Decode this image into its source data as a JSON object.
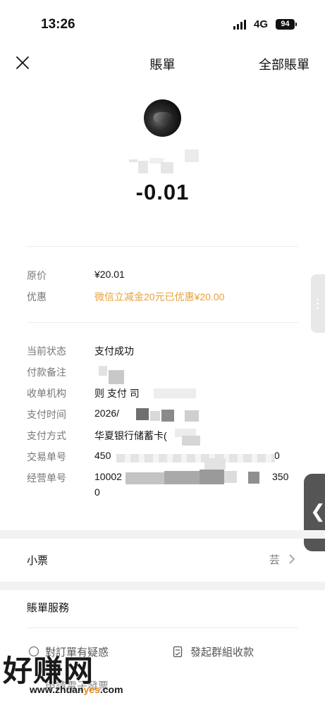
{
  "status": {
    "time": "13:26",
    "network": "4G",
    "battery": "94"
  },
  "nav": {
    "title": "賬單",
    "right_label": "全部賬單"
  },
  "amount": "-0.01",
  "price_rows": [
    {
      "label": "原价",
      "value": "¥20.01"
    },
    {
      "label": "优惠",
      "value": "微信立减金20元已优惠¥20.00"
    }
  ],
  "detail_rows": [
    {
      "label": "当前状态",
      "value": "支付成功"
    },
    {
      "label": "付款备注",
      "value": ""
    },
    {
      "label": "收单机构",
      "value": "则  支付        司"
    },
    {
      "label": "支付时间",
      "value": "2026/"
    },
    {
      "label": "支付方式",
      "value": "华夏银行储蓄卡("
    },
    {
      "label": "交易单号",
      "value": "450",
      "value_end": "0"
    },
    {
      "label": "经营单号",
      "value": "10002",
      "value_end": "350",
      "value_line2": "0"
    }
  ],
  "receipt": {
    "title": "小票",
    "right": "芸"
  },
  "services": {
    "title": "賬單服務",
    "items": [
      "對訂單有疑惑",
      "發起群組收款",
      "申請電子發票"
    ]
  },
  "watermark": {
    "text": "好赚网",
    "url_prefix": "www.zhuan",
    "url_accent": "yes",
    "url_suffix": ".com"
  },
  "colors": {
    "accent_orange": "#e9a13b",
    "label_gray": "#777777",
    "band_gray": "#f2f2f2"
  },
  "icons": [
    "close-icon",
    "chevron-right-icon",
    "chevron-left-icon",
    "document-icon",
    "help-icon"
  ]
}
